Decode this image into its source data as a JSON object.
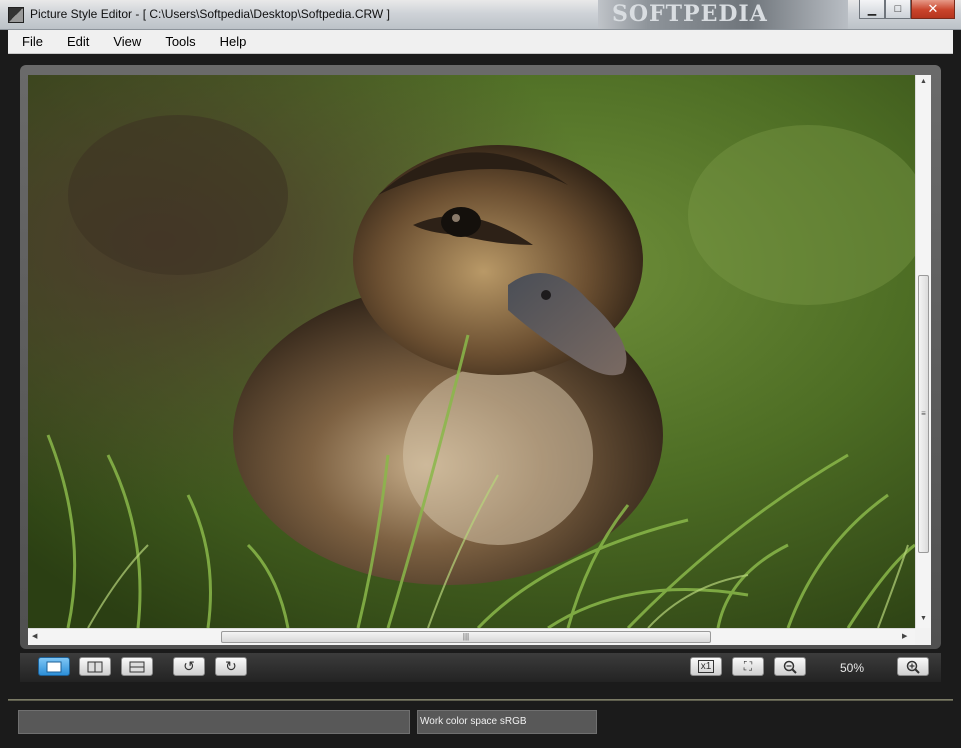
{
  "window": {
    "title": "Picture Style Editor - [ C:\\Users\\Softpedia\\Desktop\\Softpedia.CRW ]",
    "watermark": "SOFTPEDIA",
    "minimize_glyph": "▁",
    "maximize_glyph": "□",
    "close_glyph": "✕"
  },
  "menu": {
    "items": [
      "File",
      "Edit",
      "View",
      "Tools",
      "Help"
    ]
  },
  "toolbar": {
    "zoom_level": "50%",
    "icons": {
      "single_view": "single-view-icon",
      "split_view": "split-view-icon",
      "split_horizontal": "split-horizontal-icon",
      "rotate_left": "rotate-left-icon",
      "rotate_right": "rotate-right-icon",
      "actual_size": "actual-size-icon",
      "fit_window": "fit-window-icon",
      "zoom_out": "zoom-out-icon",
      "zoom_in": "zoom-in-icon"
    },
    "glyphs": {
      "rotate_left": "↺",
      "rotate_right": "↻",
      "actual_size": "x1",
      "fit_window": "⛶",
      "zoom_out": "🔍︎−",
      "zoom_in": "🔍︎+"
    }
  },
  "status": {
    "color_space": "Work color space  sRGB"
  },
  "colors": {
    "accent_active": "#2d8fd8",
    "background": "#1b1b1b"
  }
}
